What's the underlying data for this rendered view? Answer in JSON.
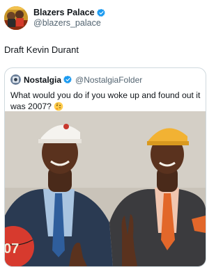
{
  "tweet": {
    "author_name": "Blazers Palace",
    "author_handle": "@blazers_palace",
    "text": "Draft Kevin Durant"
  },
  "quoted_tweet": {
    "author_name": "Nostalgia",
    "author_handle": "@NostalgiaFolder",
    "text": "What would you do if you woke up and found out it was 2007?"
  },
  "photo": {
    "basketball_text": "07"
  },
  "colors": {
    "verified": "#1d9bf0",
    "text_primary": "#0f1419",
    "text_secondary": "#536471",
    "card_border": "#cfd9de"
  },
  "icons": [
    "verified-badge-icon",
    "thinking-face-emoji"
  ]
}
